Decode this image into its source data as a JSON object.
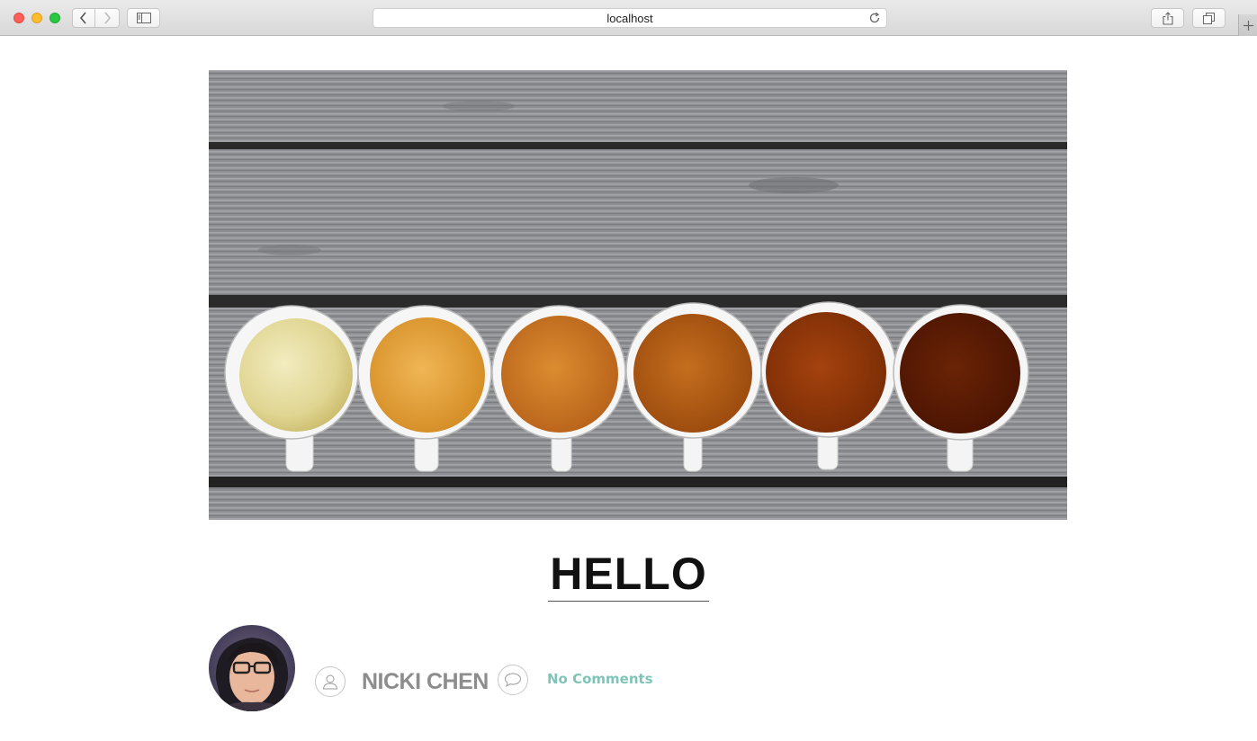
{
  "browser": {
    "address": "localhost",
    "icons": [
      "back-arrow-icon",
      "forward-arrow-icon",
      "sidebar-icon",
      "reload-icon",
      "share-icon",
      "tabs-icon",
      "plus-icon"
    ]
  },
  "post": {
    "title": "HELLO",
    "author": "NICKI CHEN",
    "comments": "No Comments"
  },
  "colors": {
    "title": "#111111",
    "author": "#8d8d8d",
    "comments": "#7fc4b8",
    "wood": "#8e9094"
  }
}
